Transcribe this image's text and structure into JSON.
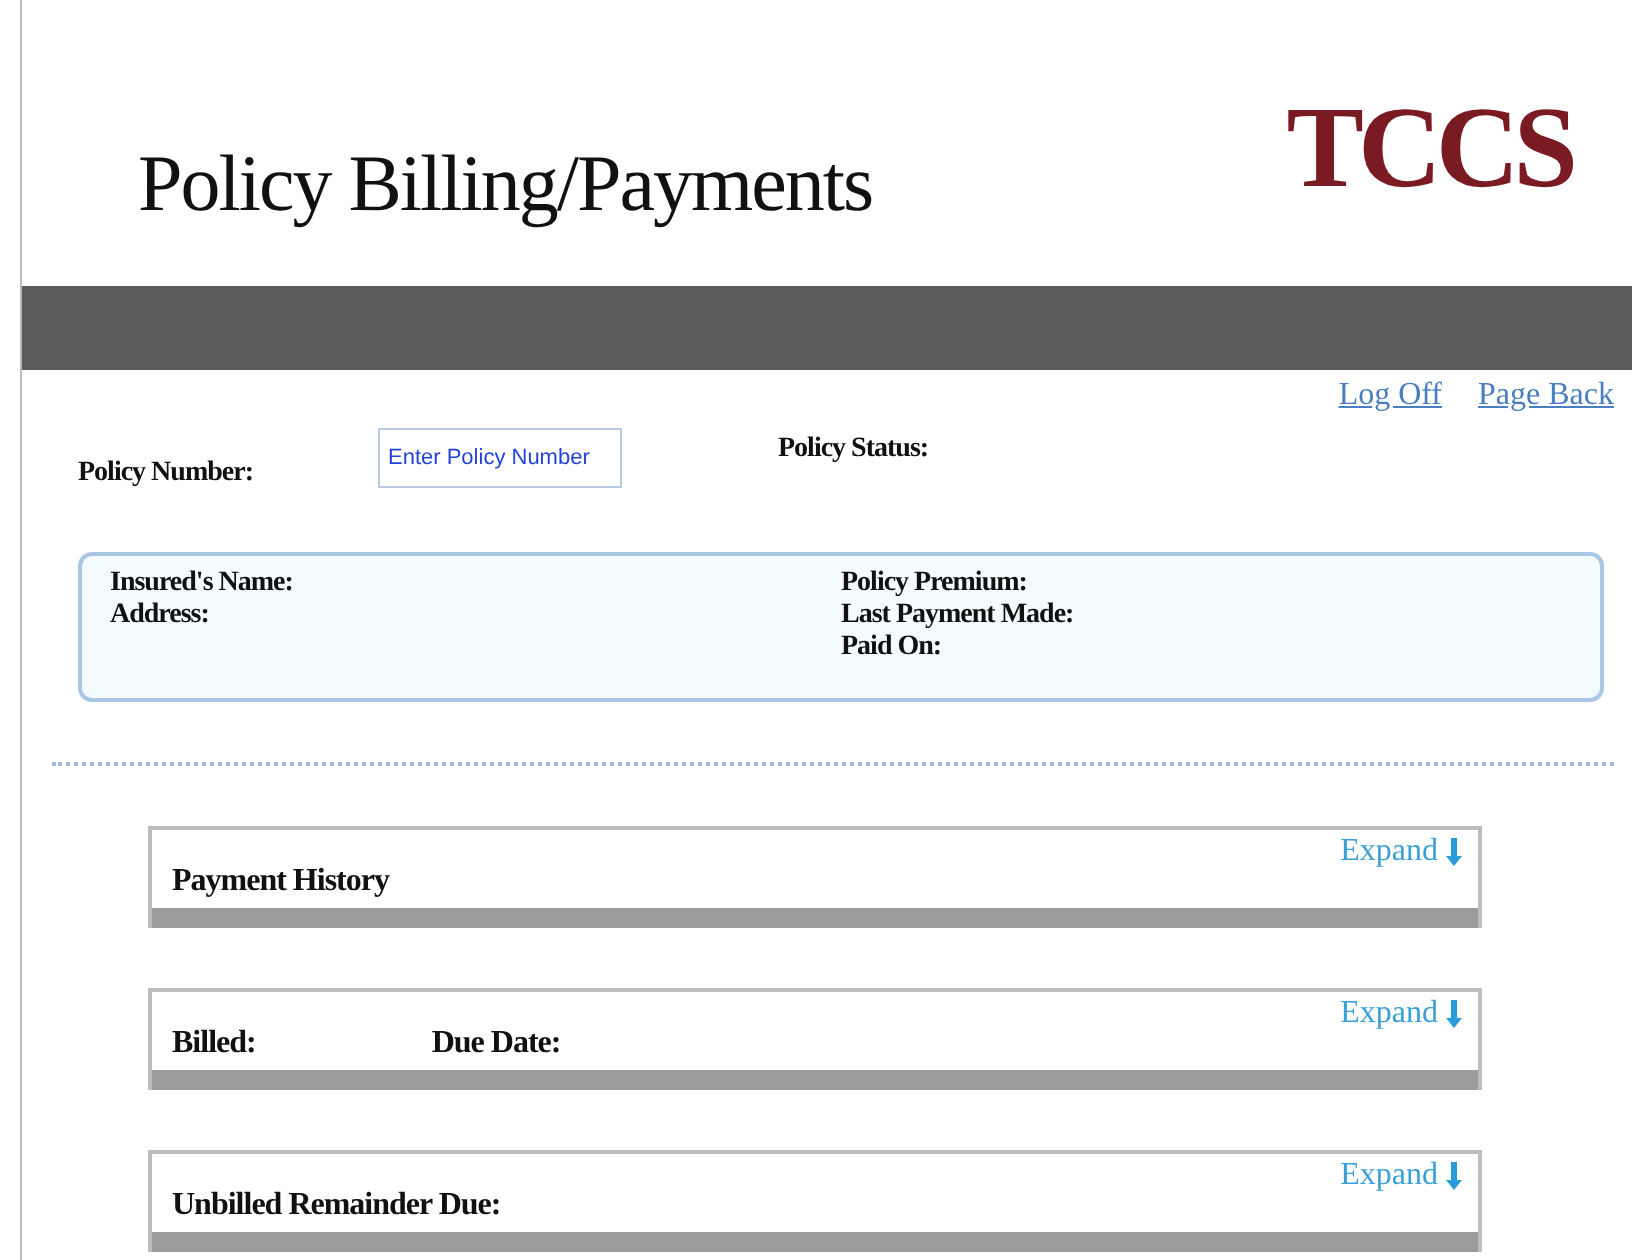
{
  "header": {
    "title": "Policy Billing/Payments",
    "logo": "TCCS"
  },
  "links": [
    "Log Off",
    "Page Back"
  ],
  "policy": {
    "number_label": "Policy Number:",
    "number_placeholder": "Enter Policy Number",
    "status_label": "Policy Status:"
  },
  "info": {
    "left": [
      "Insured's Name:",
      "Address:"
    ],
    "right": [
      "Policy Premium:",
      "Last Payment Made:",
      "Paid On:"
    ]
  },
  "sections": [
    {
      "labels": [
        "Payment History"
      ],
      "action": "Expand"
    },
    {
      "labels": [
        "Billed:",
        "Due Date:"
      ],
      "action": "Expand"
    },
    {
      "labels": [
        "Unbilled Remainder Due:"
      ],
      "action": "Expand"
    }
  ]
}
